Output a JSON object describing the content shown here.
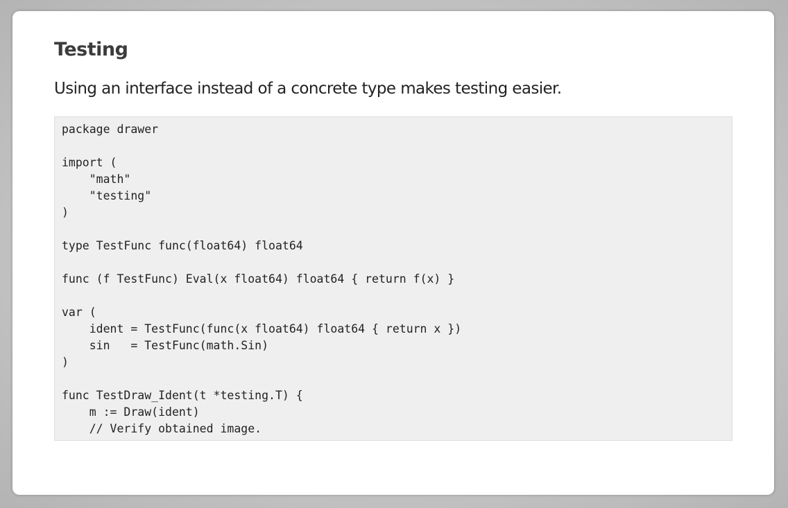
{
  "slide": {
    "title": "Testing",
    "text": "Using an interface instead of a concrete type makes testing easier."
  },
  "code": {
    "lines": [
      "package drawer",
      "",
      "import (",
      "    \"math\"",
      "    \"testing\"",
      ")",
      "",
      "type TestFunc func(float64) float64",
      "",
      "func (f TestFunc) Eval(x float64) float64 { return f(x) }",
      "",
      "var (",
      "    ident = TestFunc(func(x float64) float64 { return x })",
      "    sin   = TestFunc(math.Sin)",
      ")",
      "",
      "func TestDraw_Ident(t *testing.T) {",
      "    m := Draw(ident)",
      "    // Verify obtained image."
    ]
  }
}
